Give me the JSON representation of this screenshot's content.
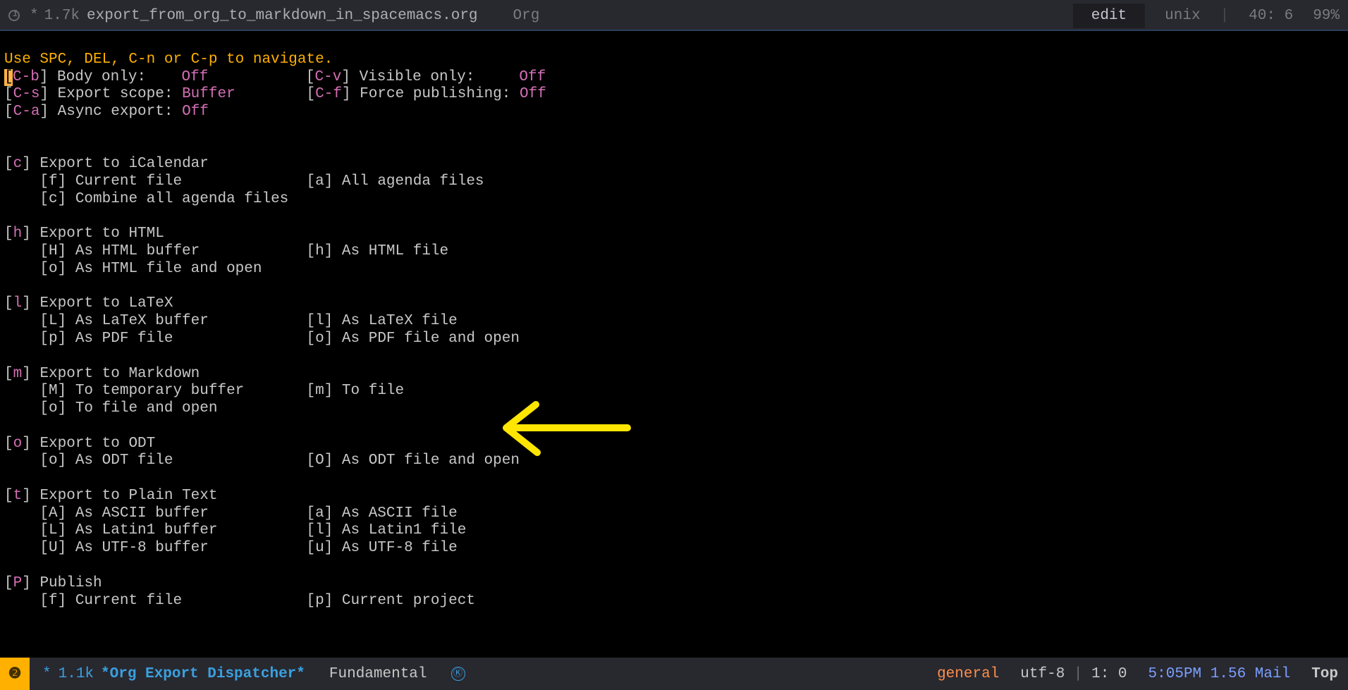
{
  "header": {
    "modified": "*",
    "size": "1.7k",
    "filename": "export_from_org_to_markdown_in_spacemacs.org",
    "major_mode": "Org",
    "edit": "edit",
    "lineenc": "unix",
    "pos": "40: 6",
    "percent": "99%"
  },
  "nav_hint": "Use SPC, DEL, C-n or C-p to navigate.",
  "toggles": {
    "body_key": "C-b",
    "body_label": "Body only:",
    "body_val": "Off",
    "visible_key": "C-v",
    "visible_label": "Visible only:",
    "visible_val": "Off",
    "scope_key": "C-s",
    "scope_label": "Export scope:",
    "scope_val": "Buffer",
    "force_key": "C-f",
    "force_label": "Force publishing:",
    "force_val": "Off",
    "async_key": "C-a",
    "async_label": "Async export:",
    "async_val": "Off"
  },
  "sections": {
    "ical": {
      "key": "c",
      "title": "Export to iCalendar",
      "f": "Current file",
      "a": "All agenda files",
      "c": "Combine all agenda files"
    },
    "html": {
      "key": "h",
      "title": "Export to HTML",
      "H": "As HTML buffer",
      "h": "As HTML file",
      "o": "As HTML file and open"
    },
    "latex": {
      "key": "l",
      "title": "Export to LaTeX",
      "L": "As LaTeX buffer",
      "l": "As LaTeX file",
      "p": "As PDF file",
      "o": "As PDF file and open"
    },
    "md": {
      "key": "m",
      "title": "Export to Markdown",
      "M": "To temporary buffer",
      "m": "To file",
      "o": "To file and open"
    },
    "odt": {
      "key": "o",
      "title": "Export to ODT",
      "o": "As ODT file",
      "O": "As ODT file and open"
    },
    "txt": {
      "key": "t",
      "title": "Export to Plain Text",
      "A": "As ASCII buffer",
      "a": "As ASCII file",
      "L": "As Latin1 buffer",
      "l": "As Latin1 file",
      "U": "As UTF-8 buffer",
      "u": "As UTF-8 file"
    },
    "pub": {
      "key": "P",
      "title": "Publish",
      "f": "Current file",
      "p": "Current project"
    }
  },
  "modeline": {
    "badge": "❷",
    "modified": "*",
    "size": "1.1k",
    "bufname": "*Org Export Dispatcher*",
    "major": "Fundamental",
    "kbd_icon": "Ⓚ",
    "general": "general",
    "encoding": "utf-8",
    "pos": "1: 0",
    "time": "5:05PM 1.56 Mail",
    "scroll": "Top"
  }
}
